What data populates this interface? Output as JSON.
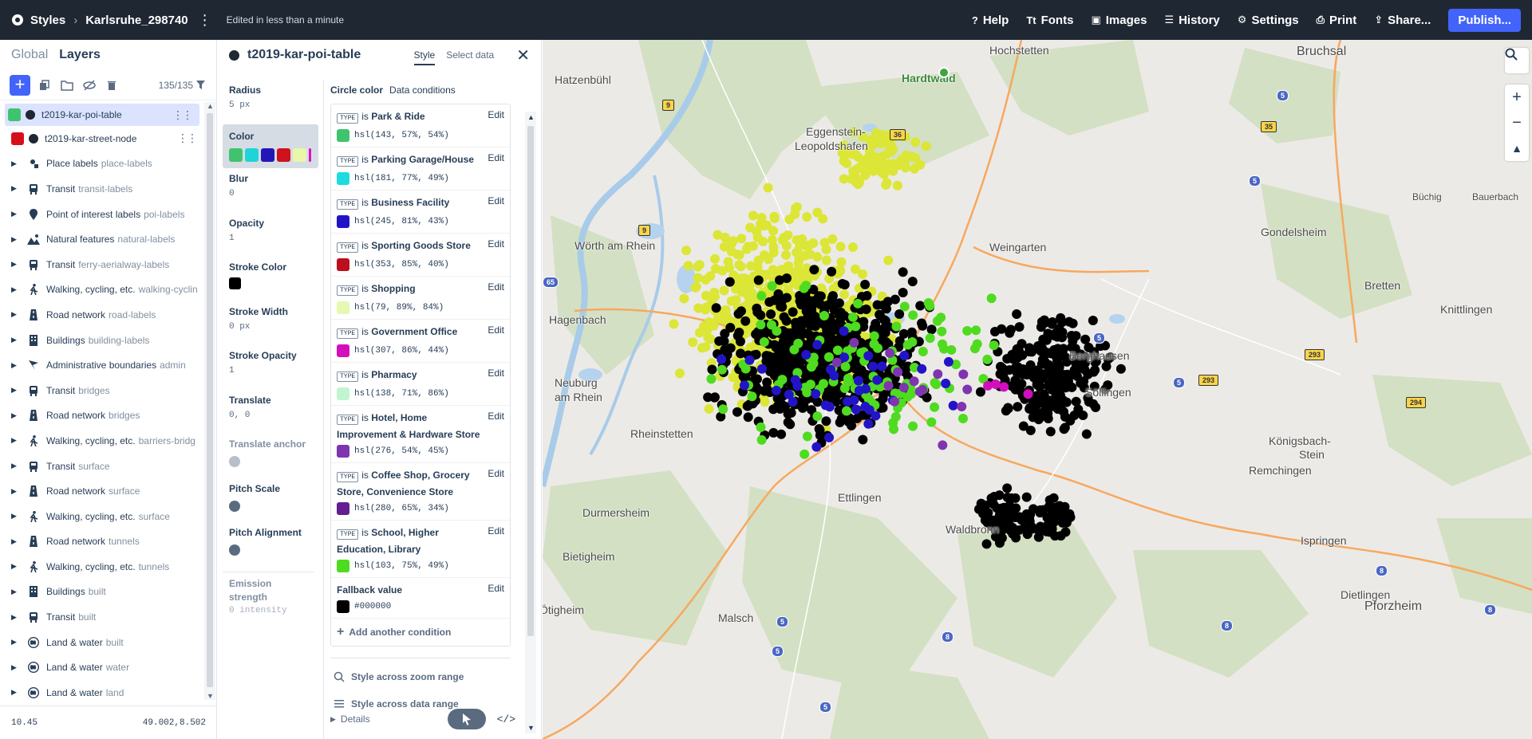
{
  "topbar": {
    "brand": "Styles",
    "style_name": "Karlsruhe_298740",
    "edited": "Edited in less than a minute",
    "menu": [
      {
        "label": "Help",
        "icon": "help-icon"
      },
      {
        "label": "Fonts",
        "icon": "fonts-icon"
      },
      {
        "label": "Images",
        "icon": "images-icon"
      },
      {
        "label": "History",
        "icon": "history-icon"
      },
      {
        "label": "Settings",
        "icon": "settings-icon"
      },
      {
        "label": "Print",
        "icon": "print-icon"
      },
      {
        "label": "Share...",
        "icon": "share-icon"
      }
    ],
    "publish": "Publish..."
  },
  "left": {
    "tabs": [
      "Global",
      "Layers"
    ],
    "count": "135/135",
    "footer_zoom": "10.45",
    "footer_coords": "49.002,8.502",
    "layers": [
      {
        "name": "t2019-kar-poi-table",
        "sub": "",
        "kind": "data",
        "swatch": "#3fc46d",
        "selected": true
      },
      {
        "name": "t2019-kar-street-node",
        "sub": "",
        "kind": "data",
        "swatch": "#d5101b",
        "selected": false
      },
      {
        "name": "Place labels",
        "sub": "place-labels",
        "kind": "group",
        "icon": "place-labels-icon"
      },
      {
        "name": "Transit",
        "sub": "transit-labels",
        "kind": "group",
        "icon": "transit-icon"
      },
      {
        "name": "Point of interest labels",
        "sub": "poi-labels",
        "kind": "group",
        "icon": "poi-pin-icon"
      },
      {
        "name": "Natural features",
        "sub": "natural-labels",
        "kind": "group",
        "icon": "natural-features-icon"
      },
      {
        "name": "Transit",
        "sub": "ferry-aerialway-labels",
        "kind": "group",
        "icon": "transit-icon"
      },
      {
        "name": "Walking, cycling, etc.",
        "sub": "walking-cyclin",
        "kind": "group",
        "icon": "walking-icon"
      },
      {
        "name": "Road network",
        "sub": "road-labels",
        "kind": "group",
        "icon": "road-icon"
      },
      {
        "name": "Buildings",
        "sub": "building-labels",
        "kind": "group",
        "icon": "buildings-icon"
      },
      {
        "name": "Administrative boundaries",
        "sub": "admin",
        "kind": "group",
        "icon": "admin-flag-icon"
      },
      {
        "name": "Transit",
        "sub": "bridges",
        "kind": "group",
        "icon": "transit-icon"
      },
      {
        "name": "Road network",
        "sub": "bridges",
        "kind": "group",
        "icon": "road-icon"
      },
      {
        "name": "Walking, cycling, etc.",
        "sub": "barriers-bridg",
        "kind": "group",
        "icon": "walking-icon"
      },
      {
        "name": "Transit",
        "sub": "surface",
        "kind": "group",
        "icon": "transit-icon"
      },
      {
        "name": "Road network",
        "sub": "surface",
        "kind": "group",
        "icon": "road-icon"
      },
      {
        "name": "Walking, cycling, etc.",
        "sub": "surface",
        "kind": "group",
        "icon": "walking-icon"
      },
      {
        "name": "Road network",
        "sub": "tunnels",
        "kind": "group",
        "icon": "road-icon"
      },
      {
        "name": "Walking, cycling, etc.",
        "sub": "tunnels",
        "kind": "group",
        "icon": "walking-icon"
      },
      {
        "name": "Buildings",
        "sub": "built",
        "kind": "group",
        "icon": "buildings-icon"
      },
      {
        "name": "Transit",
        "sub": "built",
        "kind": "group",
        "icon": "transit-icon"
      },
      {
        "name": "Land & water",
        "sub": "built",
        "kind": "group",
        "icon": "land-water-icon"
      },
      {
        "name": "Land & water",
        "sub": "water",
        "kind": "group",
        "icon": "land-water-icon"
      },
      {
        "name": "Land & water",
        "sub": "land",
        "kind": "group",
        "icon": "land-water-icon"
      }
    ]
  },
  "mid": {
    "title": "t2019-kar-poi-table",
    "tabs": [
      "Style",
      "Select data"
    ],
    "props": {
      "radius": {
        "label": "Radius",
        "value": "5 px"
      },
      "color": {
        "label": "Color",
        "chips": [
          "#3fc46d",
          "#1fd4d9",
          "#2316b8",
          "#d0121f",
          "#eaf7a9",
          "#dd11c7"
        ]
      },
      "blur": {
        "label": "Blur",
        "value": "0"
      },
      "opacity": {
        "label": "Opacity",
        "value": "1"
      },
      "stroke_color": {
        "label": "Stroke Color",
        "swatch": "#000000"
      },
      "stroke_width": {
        "label": "Stroke Width",
        "value": "0 px"
      },
      "stroke_opacity": {
        "label": "Stroke Opacity",
        "value": "1"
      },
      "translate": {
        "label": "Translate",
        "value": "0, 0"
      },
      "translate_anchor": {
        "label": "Translate anchor"
      },
      "pitch_scale": {
        "label": "Pitch Scale"
      },
      "pitch_alignment": {
        "label": "Pitch Alignment"
      },
      "emission": {
        "label": "Emission strength",
        "value": "0 intensity"
      }
    },
    "cond_title": "Circle color",
    "cond_subtitle": "Data conditions",
    "type_tag": "TYPE",
    "is_word": "is",
    "edit_label": "Edit",
    "conditions": [
      {
        "match": "Park & Ride",
        "value": "hsl(143, 57%, 54%)",
        "color": "#3fc46d"
      },
      {
        "match": "Parking Garage/House",
        "value": "hsl(181, 77%, 49%)",
        "color": "#1cdcdf"
      },
      {
        "match": "Business Facility",
        "value": "hsl(245, 81%, 43%)",
        "color": "#2214c6"
      },
      {
        "match": "Sporting Goods Store",
        "value": "hsl(353, 85%, 40%)",
        "color": "#bc0f1e"
      },
      {
        "match": "Shopping",
        "value": "hsl(79, 89%, 84%)",
        "color": "#e5f9b3"
      },
      {
        "match": "Government Office",
        "value": "hsl(307, 86%, 44%)",
        "color": "#d10fbd"
      },
      {
        "match": "Pharmacy",
        "value": "hsl(138, 71%, 86%)",
        "color": "#c1f4d0"
      },
      {
        "match": "Hotel, Home Improvement & Hardware Store",
        "value": "hsl(276, 54%, 45%)",
        "color": "#7f35b0"
      },
      {
        "match": "Coffee Shop, Grocery Store, Convenience Store",
        "value": "hsl(280, 65%, 34%)",
        "color": "#631e8f"
      },
      {
        "match": "School, Higher Education, Library",
        "value": "hsl(103, 75%, 49%)",
        "color": "#4fdb20"
      }
    ],
    "fallback_label": "Fallback value",
    "fallback_value": "#000000",
    "add_condition": "Add another condition",
    "zoom_range": "Style across zoom range",
    "data_range": "Style across data range",
    "details": "Details"
  },
  "map": {
    "labels": [
      {
        "text": "Hochstetten",
        "cls": "town"
      },
      {
        "text": "Bruchsal",
        "cls": "city"
      },
      {
        "text": "Hatzenbühl",
        "cls": "town"
      },
      {
        "text": "Hardtwald",
        "cls": "park"
      },
      {
        "text": "Eggenstein-",
        "cls": "town"
      },
      {
        "text": "Leopoldshafen",
        "cls": "town"
      },
      {
        "text": "Büchig",
        "cls": "small"
      },
      {
        "text": "Bauerbach",
        "cls": "small"
      },
      {
        "text": "Wörth am Rhein",
        "cls": "town"
      },
      {
        "text": "Weingarten",
        "cls": "town"
      },
      {
        "text": "Gondelsheim",
        "cls": "town"
      },
      {
        "text": "Bretten",
        "cls": "town"
      },
      {
        "text": "Knittlingen",
        "cls": "town"
      },
      {
        "text": "Hagenbach",
        "cls": "town"
      },
      {
        "text": "Berghausen",
        "cls": "town"
      },
      {
        "text": "Neuburg",
        "cls": "town"
      },
      {
        "text": "am Rhein",
        "cls": "town"
      },
      {
        "text": "Söllingen",
        "cls": "town"
      },
      {
        "text": "Rheinstetten",
        "cls": "town"
      },
      {
        "text": "Königsbach-",
        "cls": "town"
      },
      {
        "text": "Stein",
        "cls": "town"
      },
      {
        "text": "Remchingen",
        "cls": "town"
      },
      {
        "text": "Ettlingen",
        "cls": "town"
      },
      {
        "text": "Durmersheim",
        "cls": "town"
      },
      {
        "text": "Waldbronn",
        "cls": "town"
      },
      {
        "text": "Ispringen",
        "cls": "town"
      },
      {
        "text": "Bietigheim",
        "cls": "town"
      },
      {
        "text": "Dietlingen",
        "cls": "town"
      },
      {
        "text": "Pforzheim",
        "cls": "city"
      },
      {
        "text": "Malsch",
        "cls": "town"
      },
      {
        "text": "Ötigheim",
        "cls": "town"
      }
    ],
    "shields": [
      {
        "text": "9",
        "kind": "yellow"
      },
      {
        "text": "36",
        "kind": "yellow"
      },
      {
        "text": "35",
        "kind": "yellow"
      },
      {
        "text": "9",
        "kind": "yellow"
      },
      {
        "text": "293",
        "kind": "yellow"
      },
      {
        "text": "293",
        "kind": "yellow"
      },
      {
        "text": "294",
        "kind": "yellow"
      },
      {
        "text": "5",
        "kind": "blue"
      },
      {
        "text": "5",
        "kind": "blue"
      },
      {
        "text": "5",
        "kind": "blue"
      },
      {
        "text": "65",
        "kind": "blue"
      },
      {
        "text": "5",
        "kind": "blue"
      },
      {
        "text": "8",
        "kind": "blue"
      },
      {
        "text": "5",
        "kind": "blue"
      },
      {
        "text": "5",
        "kind": "blue"
      },
      {
        "text": "8",
        "kind": "blue"
      },
      {
        "text": "8",
        "kind": "blue"
      },
      {
        "text": "8",
        "kind": "blue"
      },
      {
        "text": "5",
        "kind": "blue"
      }
    ],
    "controls": [
      "search-icon",
      "zoom-in-icon",
      "zoom-out-icon",
      "compass-icon"
    ]
  }
}
